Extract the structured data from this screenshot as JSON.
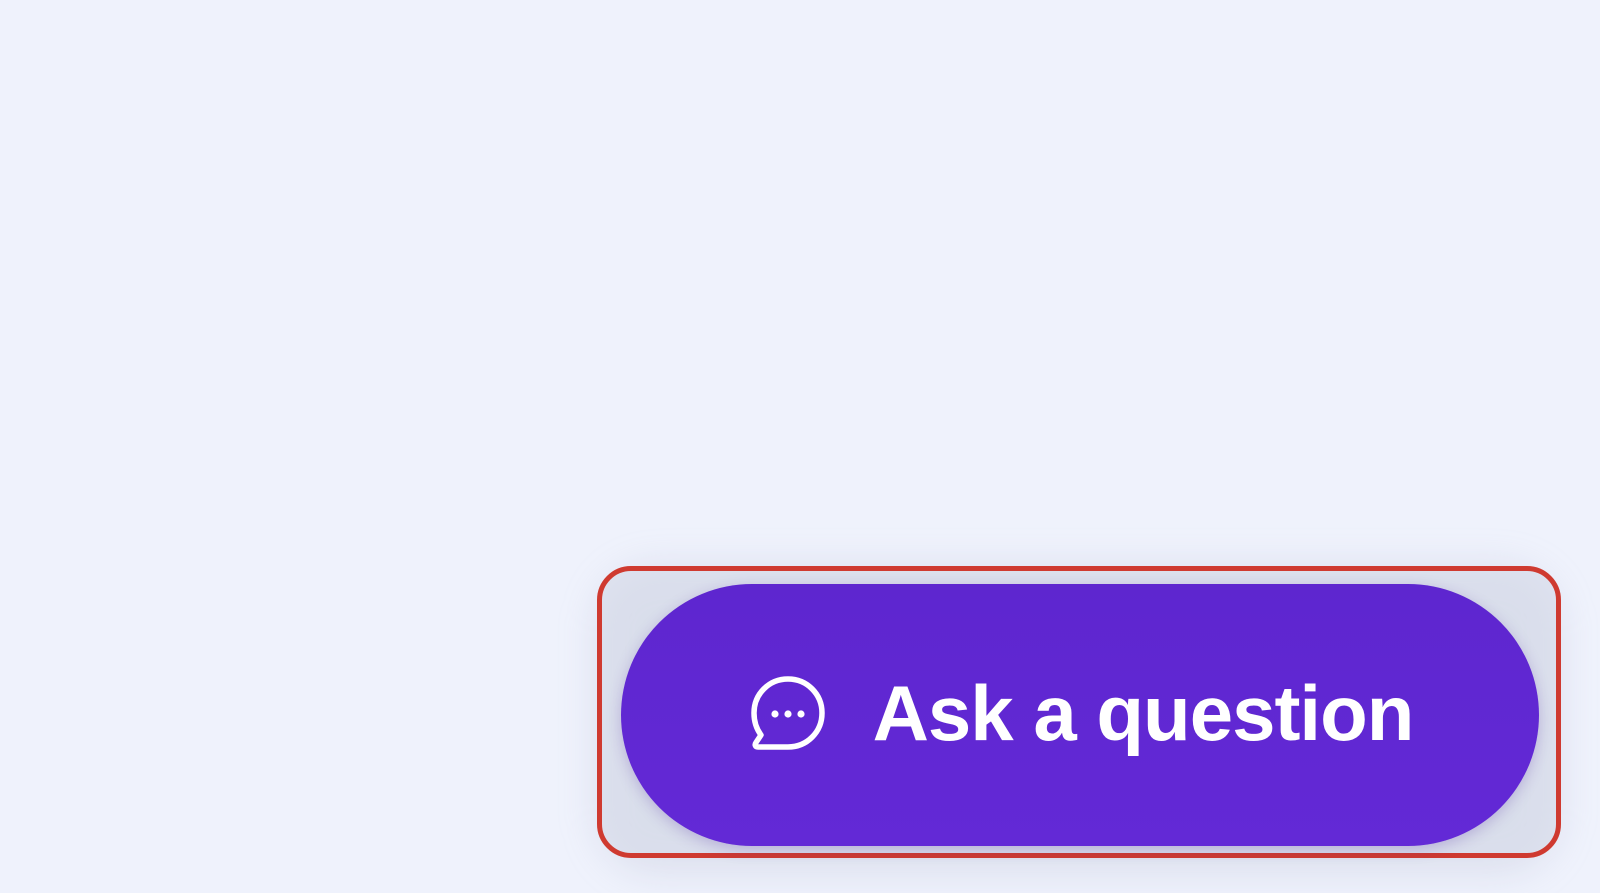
{
  "colors": {
    "page_background": "#eff2fc",
    "button_background": "#6128d3",
    "button_text": "#ffffff",
    "highlight_border": "#cf3a30"
  },
  "fab": {
    "label": "Ask a question",
    "icon": "chat-bubble-ellipsis-icon"
  }
}
